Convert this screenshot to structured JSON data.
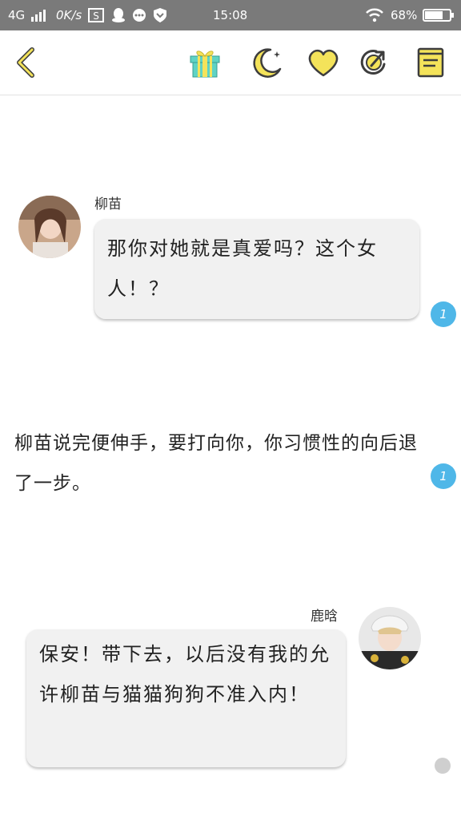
{
  "status_bar": {
    "network": "4G",
    "speed": "0K/s",
    "time": "15:08",
    "battery": "68%",
    "icons": [
      "signal-icon",
      "sim-icon",
      "qq-icon",
      "message-icon",
      "shield-icon",
      "wifi-icon",
      "battery-icon"
    ]
  },
  "toolbar": {
    "icons": [
      "back-icon",
      "gift-icon",
      "moon-icon",
      "heart-icon",
      "share-icon",
      "book-icon"
    ],
    "accent": "#f4e35a",
    "outline": "#3d3d3d"
  },
  "messages": [
    {
      "speaker": "柳苗",
      "text": "那你对她就是真爱吗？这个女人！？",
      "comment_count": "1"
    },
    {
      "narration": "柳苗说完便伸手，要打向你，你习惯性的向后退了一步。",
      "comment_count": "1"
    },
    {
      "speaker": "鹿晗",
      "text": "保安！带下去，以后没有我的允许柳苗与猫猫狗狗不准入内！"
    }
  ]
}
